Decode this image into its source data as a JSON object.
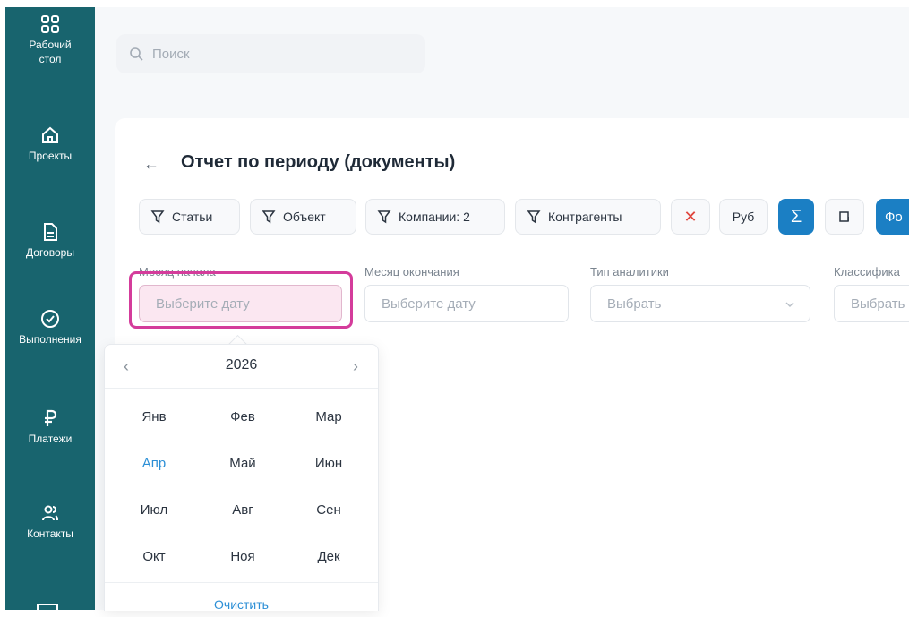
{
  "sidebar": {
    "items": [
      {
        "label": "Рабочий стол",
        "icon": "dashboard-icon"
      },
      {
        "label": "Проекты",
        "icon": "home-icon"
      },
      {
        "label": "Договоры",
        "icon": "document-icon"
      },
      {
        "label": "Выполнения",
        "icon": "check-circle-icon"
      },
      {
        "label": "Платежи",
        "icon": "ruble-icon"
      },
      {
        "label": "Контакты",
        "icon": "users-icon"
      }
    ]
  },
  "search": {
    "placeholder": "Поиск"
  },
  "page": {
    "title": "Отчет по периоду (документы)"
  },
  "filters": {
    "articles": "Статьи",
    "object": "Объект",
    "companies": "Компании: 2",
    "counterparties": "Контрагенты",
    "currency": "Руб",
    "sum_symbol": "Σ",
    "form_label": "Фо"
  },
  "fields": {
    "start_month": {
      "label": "Месяц начала",
      "placeholder": "Выберите дату"
    },
    "end_month": {
      "label": "Месяц окончания",
      "placeholder": "Выберите дату"
    },
    "analytics_type": {
      "label": "Тип аналитики",
      "placeholder": "Выбрать"
    },
    "classification": {
      "label": "Классифика",
      "placeholder": "Выбрать"
    }
  },
  "calendar": {
    "year": "2026",
    "months": [
      "Янв",
      "Фев",
      "Мар",
      "Апр",
      "Май",
      "Июн",
      "Июл",
      "Авг",
      "Сен",
      "Окт",
      "Ноя",
      "Дек"
    ],
    "current_month": "Апр",
    "clear_label": "Очистить"
  },
  "colors": {
    "sidebar": "#18646e",
    "accent": "#1b7fc4",
    "highlight": "#d43c9b",
    "link": "#2c8fd6"
  }
}
